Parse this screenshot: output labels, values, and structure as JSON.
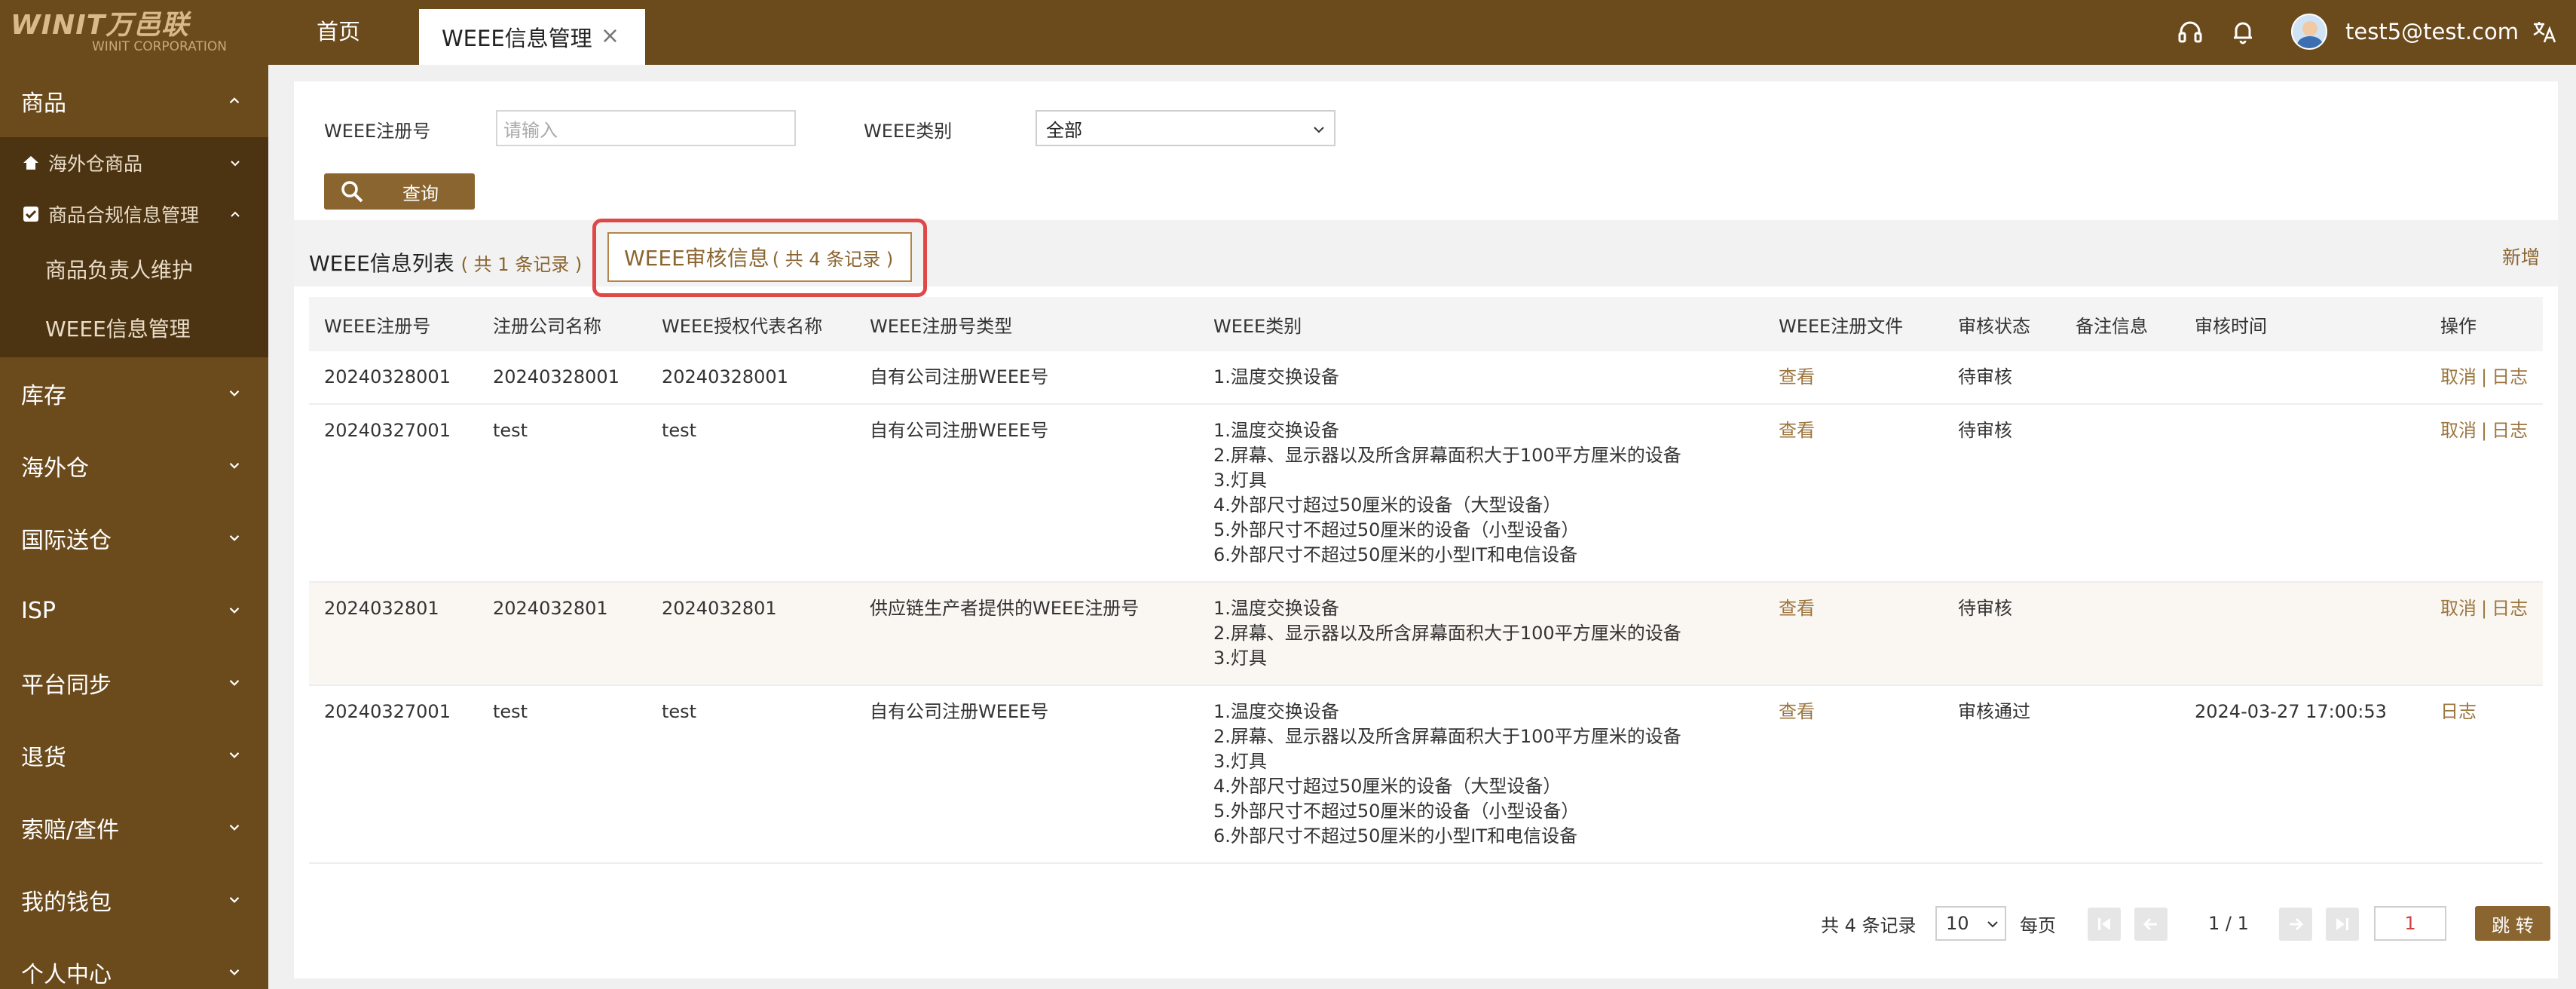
{
  "brand": {
    "logo_main": "WINIT万邑联",
    "logo_sub": "WINIT CORPORATION"
  },
  "topbar": {
    "home_tab": "首页",
    "active_tab": "WEEE信息管理",
    "close_glyph": "×",
    "user_email": "test5@test.com",
    "icons": [
      "headset-icon",
      "bell-icon",
      "translate-icon"
    ]
  },
  "sidebar": {
    "groups": [
      {
        "label": "商品"
      },
      {
        "label": "库存"
      },
      {
        "label": "海外仓"
      },
      {
        "label": "国际送仓"
      },
      {
        "label": "ISP"
      },
      {
        "label": "平台同步"
      },
      {
        "label": "退货"
      },
      {
        "label": "索赔/查件"
      },
      {
        "label": "我的钱包"
      },
      {
        "label": "个人中心"
      }
    ],
    "sub": [
      {
        "label": "海外仓商品",
        "icon": "home-icon"
      },
      {
        "label": "商品合规信息管理",
        "icon": "checkbox-icon"
      }
    ],
    "leaves": [
      "商品负责人维护",
      "WEEE信息管理"
    ]
  },
  "filters": {
    "reg_no_label": "WEEE注册号",
    "reg_no_placeholder": "请输入",
    "category_label": "WEEE类别",
    "category_value": "全部",
    "query_button": "查询"
  },
  "tabs": {
    "list_label": "WEEE信息列表",
    "list_count": "( 共 1 条记录 )",
    "audit_label": "WEEE审核信息",
    "audit_count": "( 共 4 条记录 )",
    "add_button": "新增"
  },
  "table": {
    "headers": [
      "WEEE注册号",
      "注册公司名称",
      "WEEE授权代表名称",
      "WEEE注册号类型",
      "WEEE类别",
      "WEEE注册文件",
      "审核状态",
      "备注信息",
      "审核时间",
      "操作"
    ],
    "rows": [
      {
        "reg_no": "20240328001",
        "company": "20240328001",
        "rep": "20240328001",
        "type": "自有公司注册WEEE号",
        "categories": [
          "1.温度交换设备"
        ],
        "file": "查看",
        "status": "待审核",
        "remark": "",
        "time": "",
        "ops": [
          "取消",
          "日志"
        ]
      },
      {
        "reg_no": "20240327001",
        "company": "test",
        "rep": "test",
        "type": "自有公司注册WEEE号",
        "categories": [
          "1.温度交换设备",
          "2.屏幕、显示器以及所含屏幕面积大于100平方厘米的设备",
          "3.灯具",
          "4.外部尺寸超过50厘米的设备（大型设备）",
          "5.外部尺寸不超过50厘米的设备（小型设备）",
          "6.外部尺寸不超过50厘米的小型IT和电信设备"
        ],
        "file": "查看",
        "status": "待审核",
        "remark": "",
        "time": "",
        "ops": [
          "取消",
          "日志"
        ]
      },
      {
        "reg_no": "2024032801",
        "company": "2024032801",
        "rep": "2024032801",
        "type": "供应链生产者提供的WEEE注册号",
        "categories": [
          "1.温度交换设备",
          "2.屏幕、显示器以及所含屏幕面积大于100平方厘米的设备",
          "3.灯具"
        ],
        "file": "查看",
        "status": "待审核",
        "remark": "",
        "time": "",
        "ops": [
          "取消",
          "日志"
        ]
      },
      {
        "reg_no": "20240327001",
        "company": "test",
        "rep": "test",
        "type": "自有公司注册WEEE号",
        "categories": [
          "1.温度交换设备",
          "2.屏幕、显示器以及所含屏幕面积大于100平方厘米的设备",
          "3.灯具",
          "4.外部尺寸超过50厘米的设备（大型设备）",
          "5.外部尺寸不超过50厘米的设备（小型设备）",
          "6.外部尺寸不超过50厘米的小型IT和电信设备"
        ],
        "file": "查看",
        "status": "审核通过",
        "remark": "",
        "time": "2024-03-27 17:00:53",
        "ops": [
          "日志"
        ]
      }
    ]
  },
  "pager": {
    "total": "共 4 条记录",
    "page_size": "10",
    "per_page": "每页",
    "page_info": "1 / 1",
    "page_input": "1",
    "jump_button": "跳 转"
  },
  "colors": {
    "brand": "#6b4a1c",
    "accent": "#8b6530",
    "highlight": "#e04848"
  }
}
